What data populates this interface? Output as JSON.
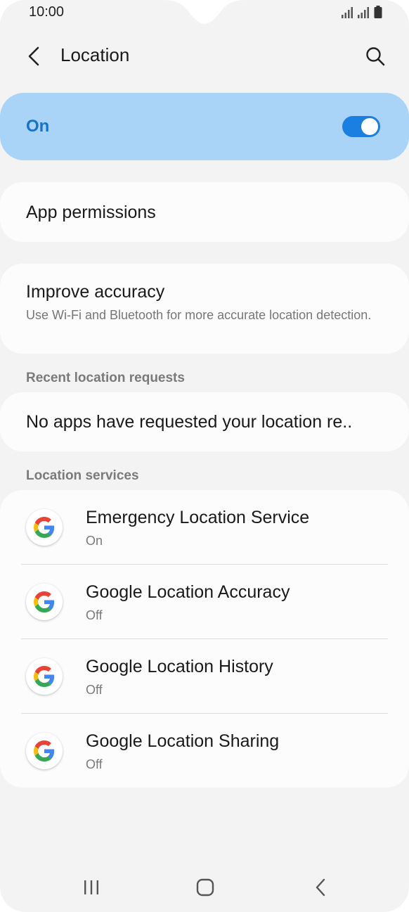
{
  "status_bar": {
    "time": "10:00"
  },
  "header": {
    "title": "Location"
  },
  "master_switch": {
    "label": "On",
    "enabled": true,
    "accent_color": "#1a7fe0",
    "background_color": "#a9d3f7"
  },
  "app_permissions": {
    "title": "App permissions"
  },
  "improve_accuracy": {
    "title": "Improve accuracy",
    "subtitle": "Use Wi-Fi and Bluetooth for more accurate location detection."
  },
  "recent_requests": {
    "section_title": "Recent location requests",
    "message": "No apps have requested your location re.."
  },
  "location_services": {
    "section_title": "Location services",
    "items": [
      {
        "name": "Emergency Location Service",
        "status": "On",
        "icon": "google-g-icon"
      },
      {
        "name": "Google Location Accuracy",
        "status": "Off",
        "icon": "google-g-icon"
      },
      {
        "name": "Google Location History",
        "status": "Off",
        "icon": "google-g-icon"
      },
      {
        "name": "Google Location Sharing",
        "status": "Off",
        "icon": "google-g-icon"
      }
    ]
  },
  "nav_bar": {
    "icons": [
      "recents-icon",
      "home-icon",
      "back-icon"
    ]
  }
}
